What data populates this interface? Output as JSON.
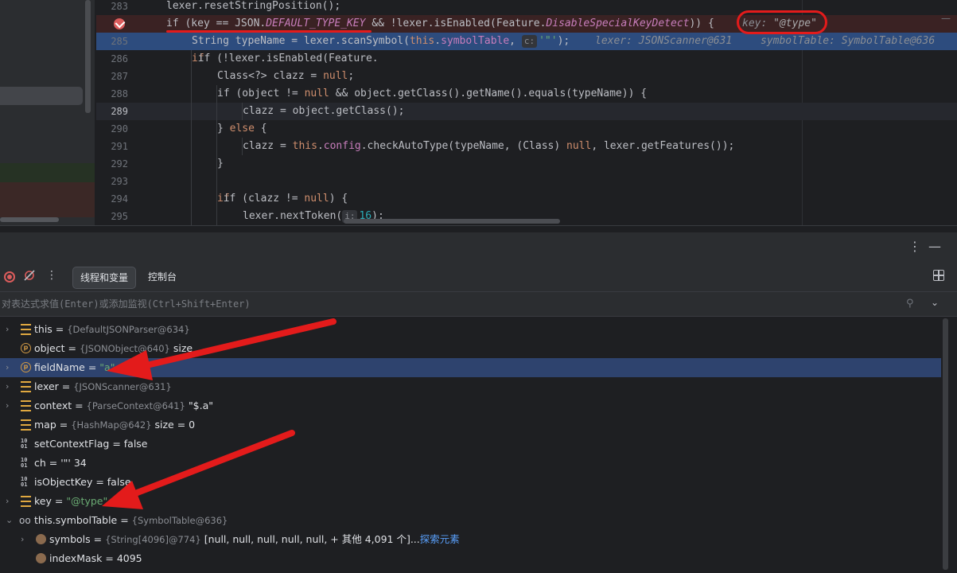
{
  "editor": {
    "lines": [
      {
        "num": "283",
        "id": "283"
      },
      {
        "num": "",
        "id": "284"
      },
      {
        "num": "285",
        "id": "285"
      },
      {
        "num": "286",
        "id": "286"
      },
      {
        "num": "287",
        "id": "287"
      },
      {
        "num": "288",
        "id": "288"
      },
      {
        "num": "289",
        "id": "289"
      },
      {
        "num": "290",
        "id": "290"
      },
      {
        "num": "291",
        "id": "291"
      },
      {
        "num": "292",
        "id": "292"
      },
      {
        "num": "293",
        "id": "293"
      },
      {
        "num": "294",
        "id": "294"
      },
      {
        "num": "295",
        "id": "295"
      }
    ],
    "l283": "lexer.resetStringPosition();",
    "l284": {
      "a": "if (key == JSON.",
      "b": "DEFAULT_TYPE_KEY",
      "c": " && !lexer.isEnabled(Feature.",
      "d": "DisableSpecialKeyDetect",
      "e": ")) {",
      "hint_key": "key: ",
      "hint_val": "\"@type\""
    },
    "l285": {
      "a": "String typeName = lexer.scanSymbol(",
      "b": "this",
      "c": ".",
      "d": "symbolTable",
      "e": ", ",
      "hint_c": "c:",
      "f": "'\"'",
      "g": ");",
      "hint1": "lexer: JSONScanner@631",
      "hint2": "symbolTable: SymbolTable@636"
    },
    "l286": {
      "a": "if (!lexer.isEnabled(Feature.",
      "b": "IgnoreAutoType",
      "c": ")) {"
    },
    "l287": {
      "a": "Class<?> clazz = ",
      "b": "null",
      "c": ";"
    },
    "l288": {
      "a": "if (object != ",
      "b": "null",
      "c": " && object.getClass().getName().equals(typeName)) {"
    },
    "l289": "clazz = object.getClass();",
    "l290": {
      "a": "} ",
      "b": "else",
      "c": " {"
    },
    "l291": {
      "a": "clazz = ",
      "b": "this",
      "c": ".",
      "d": "config",
      "e": ".checkAutoType(typeName, (Class) ",
      "f": "null",
      "g": ", lexer.getFeatures());"
    },
    "l292": "}",
    "l294": {
      "a": "if (clazz != ",
      "b": "null",
      "c": ") {"
    },
    "l295": {
      "a": "lexer.nextToken(",
      "hint_i": "i:",
      "b": "16",
      "c": ");"
    }
  },
  "debug": {
    "more_icon": "⋮",
    "minimize_icon": "—",
    "tabs": {
      "threads": "线程和变量",
      "console": "控制台"
    },
    "eval_placeholder": "对表达式求值(Enter)或添加监视(Ctrl+Shift+Enter)"
  },
  "variables": [
    {
      "name": "this",
      "type": "{DefaultJSONParser@634}",
      "rest": "",
      "icon": "field",
      "expandable": true
    },
    {
      "name": "object",
      "type": "{JSONObject@640}",
      "rest": "size",
      "icon": "p",
      "expandable": false
    },
    {
      "name": "fieldName",
      "type": "",
      "val": "\"a\"",
      "icon": "p",
      "expandable": true,
      "selected": true
    },
    {
      "name": "lexer",
      "type": "{JSONScanner@631}",
      "rest": "",
      "icon": "field",
      "expandable": true
    },
    {
      "name": "context",
      "type": "{ParseContext@641}",
      "rest": "\"$.a\"",
      "icon": "field",
      "expandable": true
    },
    {
      "name": "map",
      "type": "{HashMap@642}",
      "rest": "size = 0",
      "icon": "field",
      "expandable": false
    },
    {
      "name": "setContextFlag",
      "type": "",
      "rest": "false",
      "icon": "bin",
      "expandable": false
    },
    {
      "name": "ch",
      "type": "",
      "rest": "'\"' 34",
      "icon": "bin",
      "expandable": false
    },
    {
      "name": "isObjectKey",
      "type": "",
      "rest": "false",
      "icon": "bin",
      "expandable": false
    },
    {
      "name": "key",
      "type": "",
      "val": "\"@type\"",
      "icon": "field",
      "expandable": true
    },
    {
      "name": "this.symbolTable",
      "type": "{SymbolTable@636}",
      "rest": "",
      "icon": "glasses",
      "expandable": true,
      "expanded": true
    },
    {
      "name": "symbols",
      "type": "{String[4096]@774}",
      "rest": "[null, null, null, null, null, + 其他 4,091 个]...",
      "link": "探索元素",
      "icon": "arr",
      "expandable": true,
      "child": true
    },
    {
      "name": "indexMask",
      "type": "",
      "rest": "4095",
      "icon": "arr",
      "expandable": false,
      "child": true
    }
  ],
  "colors": {
    "annotation": "#e31b1b",
    "selection": "#2e436e",
    "string": "#6aab73",
    "keyword": "#cf8e6d"
  }
}
